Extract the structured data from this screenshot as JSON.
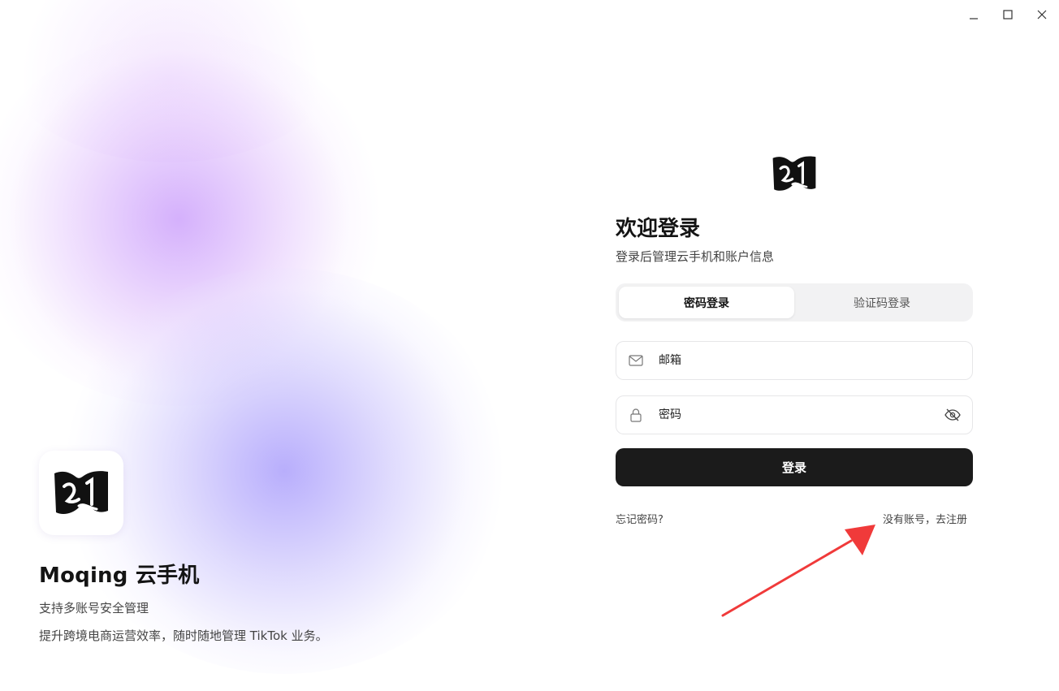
{
  "window": {
    "controls": {
      "minimize_icon": "minimize-icon",
      "maximize_icon": "maximize-icon",
      "close_icon": "close-icon"
    }
  },
  "hero": {
    "app_name": "Moqing 云手机",
    "tagline_1": "支持多账号安全管理",
    "tagline_2": "提升跨境电商运营效率，随时随地管理 TikTok 业务。",
    "logo_icon": "moqing-logo-icon"
  },
  "login": {
    "title": "欢迎登录",
    "subtitle": "登录后管理云手机和账户信息",
    "tabs": [
      {
        "label": "密码登录",
        "active": true
      },
      {
        "label": "验证码登录",
        "active": false
      }
    ],
    "email": {
      "placeholder": "邮箱",
      "value": "",
      "icon": "mail-icon"
    },
    "password": {
      "placeholder": "密码",
      "value": "",
      "icon": "lock-icon",
      "toggle_icon": "eye-off-icon"
    },
    "submit_label": "登录",
    "forgot_label": "忘记密码?",
    "register_label": "没有账号，去注册"
  },
  "colors": {
    "primary_button": "#1b1b1b",
    "tab_track": "#f2f2f3",
    "annotation_arrow": "#f03a3a",
    "gradient_purple": "#d0a8fc",
    "gradient_violet": "#aca0fc"
  }
}
